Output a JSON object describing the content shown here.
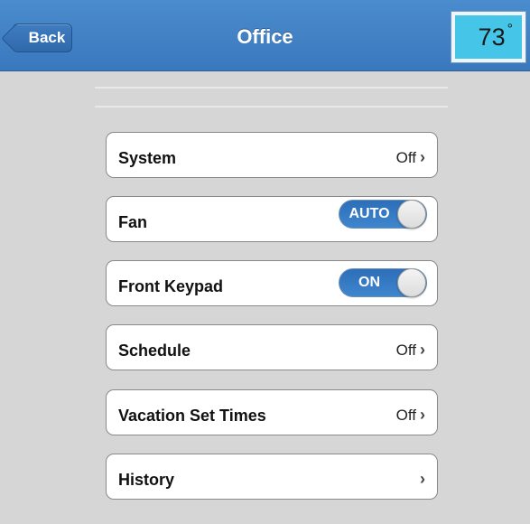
{
  "header": {
    "back_label": "Back",
    "title": "Office",
    "temperature": "73",
    "temperature_unit": "°"
  },
  "rows": [
    {
      "label": "System",
      "value": "Off",
      "control": "chevron"
    },
    {
      "label": "Fan",
      "value": "AUTO",
      "control": "toggle"
    },
    {
      "label": "Front Keypad",
      "value": "ON",
      "control": "toggle"
    },
    {
      "label": "Schedule",
      "value": "Off",
      "control": "chevron"
    },
    {
      "label": "Vacation Set Times",
      "value": "Off",
      "control": "chevron"
    },
    {
      "label": "History",
      "value": "",
      "control": "chevron"
    }
  ],
  "icons": {
    "chevron": "chevron-right-icon",
    "back": "back-arrow-icon"
  },
  "colors": {
    "header": "#3f80c4",
    "temperature_bg": "#45c6e8",
    "toggle_on": "#2f72bc",
    "background": "#d6d6d6"
  }
}
